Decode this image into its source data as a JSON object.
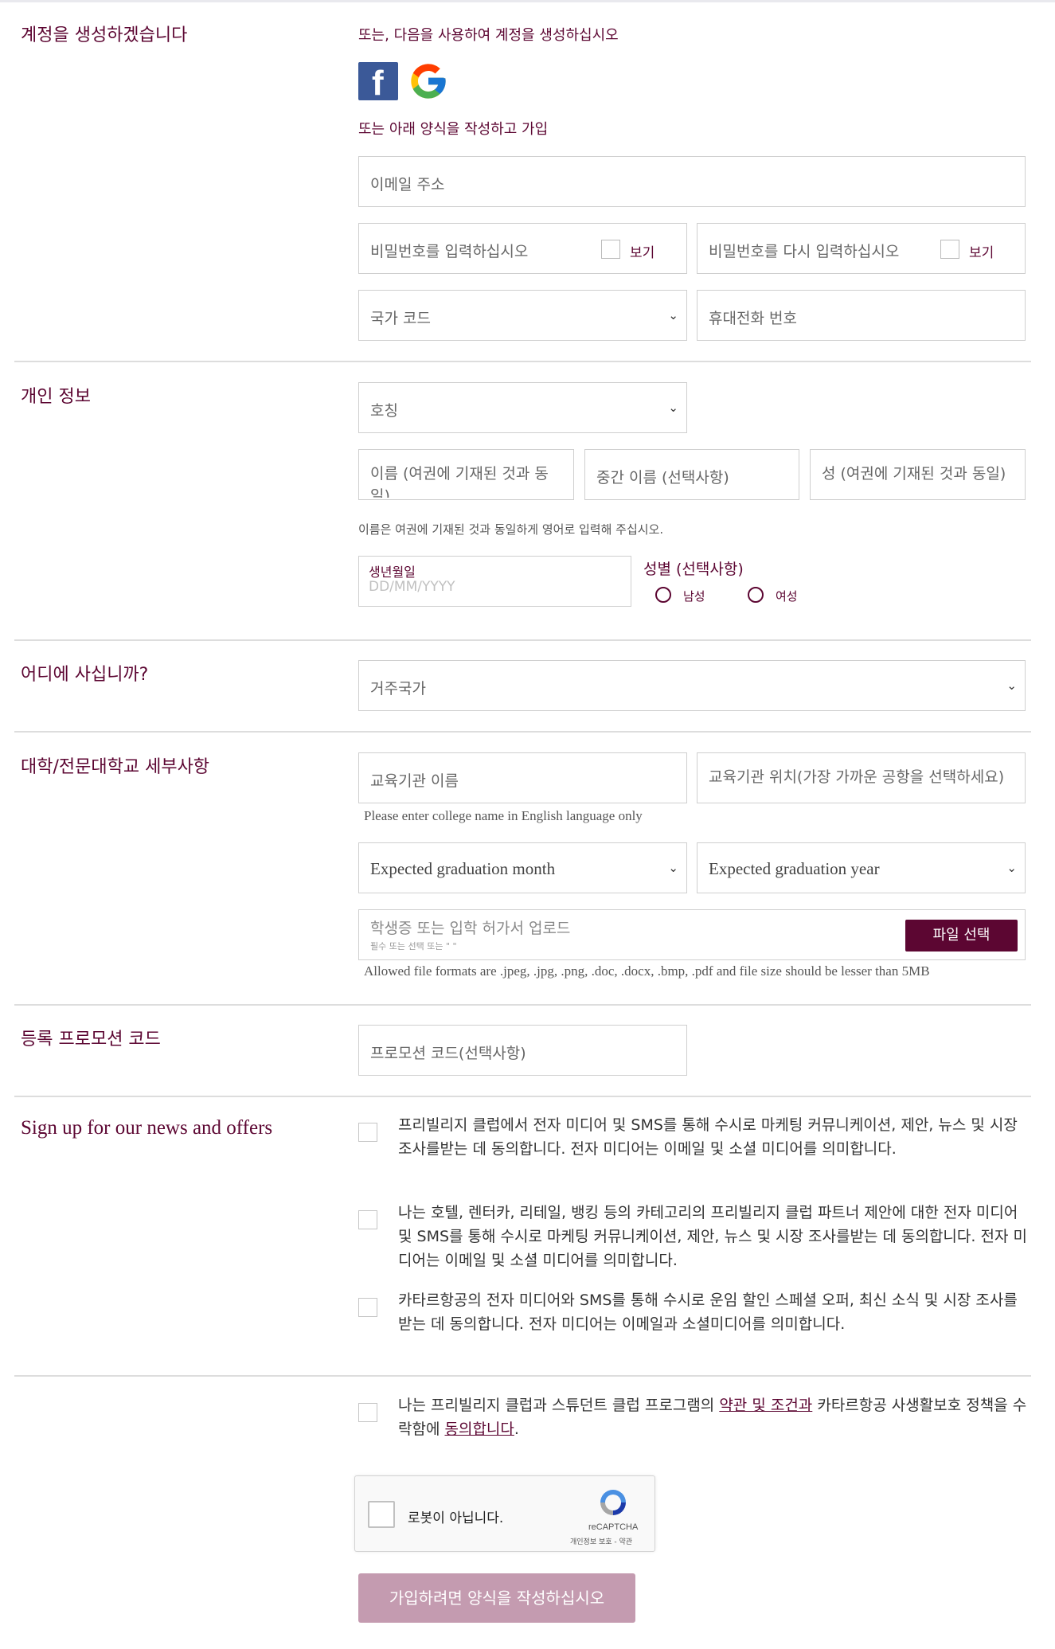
{
  "account": {
    "title": "계정을 생성하겠습니다",
    "social_prompt": "또는, 다음을 사용하여 계정을 생성하십시오",
    "form_prompt": "또는 아래 양식을 작성하고 가입",
    "email_placeholder": "이메일 주소",
    "password_placeholder": "비밀번호를 입력하십시오",
    "password_show": "보기",
    "password_confirm_placeholder": "비밀번호를 다시 입력하십시오",
    "password_confirm_show": "보기",
    "country_code_placeholder": "국가 코드",
    "mobile_placeholder": "휴대전화 번호",
    "facebook_glyph": "f",
    "google_glyph": "G"
  },
  "personal": {
    "title": "개인 정보",
    "salutation_placeholder": "호칭",
    "first_name_placeholder": "이름 (여권에 기재된 것과 동일)",
    "middle_name_placeholder": "중간 이름 (선택사항)",
    "last_name_placeholder": "성 (여권에 기재된 것과 동일)",
    "name_hint": "이름은 여권에 기재된 것과 동일하게 영어로 입력해 주십시오.",
    "dob_label": "생년월일",
    "dob_placeholder": "DD/MM/YYYY",
    "gender_label": "성별 (선택사항)",
    "gender_male": "남성",
    "gender_female": "여성"
  },
  "residence": {
    "title": "어디에 사십니까?",
    "country_placeholder": "거주국가"
  },
  "college": {
    "title": "대학/전문대학교 세부사항",
    "name_placeholder": "교육기관 이름",
    "name_hint": "Please enter college name in English language only",
    "location_placeholder": "교육기관 위치(가장 가까운 공항을 선택하세요)",
    "grad_month_placeholder": "Expected graduation month",
    "grad_year_placeholder": "Expected graduation year",
    "upload_placeholder": "학생증 또는 입학 허가서 업로드",
    "upload_sub": "필수 또는 선택 또는 \" \"",
    "upload_button": "파일 선택",
    "upload_hint": "Allowed file formats are .jpeg, .jpg, .png, .doc, .docx, .bmp, .pdf and file size should be lesser than 5MB"
  },
  "promo": {
    "title": "등록 프로모션 코드",
    "code_placeholder": "프로모션 코드(선택사항)"
  },
  "news": {
    "title": "Sign up for our news and offers",
    "consent_1": "프리빌리지 클럽에서 전자 미디어 및 SMS를 통해 수시로 마케팅 커뮤니케이션, 제안, 뉴스 및 시장 조사를받는 데 동의합니다. 전자 미디어는 이메일 및 소셜 미디어를 의미합니다.",
    "consent_2": "나는 호텔, 렌터카, 리테일, 뱅킹 등의 카테고리의 프리빌리지 클럽 파트너 제안에 대한 전자 미디어 및 SMS를 통해 수시로 마케팅 커뮤니케이션, 제안, 뉴스 및 시장 조사를받는 데 동의합니다. 전자 미디어는 이메일 및 소셜 미디어를 의미합니다.",
    "consent_3": "카타르항공의 전자 미디어와 SMS를 통해 수시로 운임 할인 스페셜 오퍼, 최신 소식 및 시장 조사를 받는 데 동의합니다. 전자 미디어는 이메일과 소셜미디어를 의미합니다."
  },
  "terms": {
    "text_before": "나는 프리빌리지 클럽과 스튜던트 클럽 프로그램의 ",
    "terms_link": "약관 및 조건과",
    "text_middle": " 카타르항공 사생활보호 정책을 수락함에 ",
    "agree_link": "동의합니다",
    "text_after": "."
  },
  "captcha": {
    "label": "로봇이 아닙니다.",
    "brand": "reCAPTCHA",
    "links": "개인정보 보호 - 약관"
  },
  "submit": {
    "label": "가입하려면 양식을 작성하십시오"
  },
  "colors": {
    "brand": "#5c0632",
    "submit_disabled": "#c49bb0"
  }
}
